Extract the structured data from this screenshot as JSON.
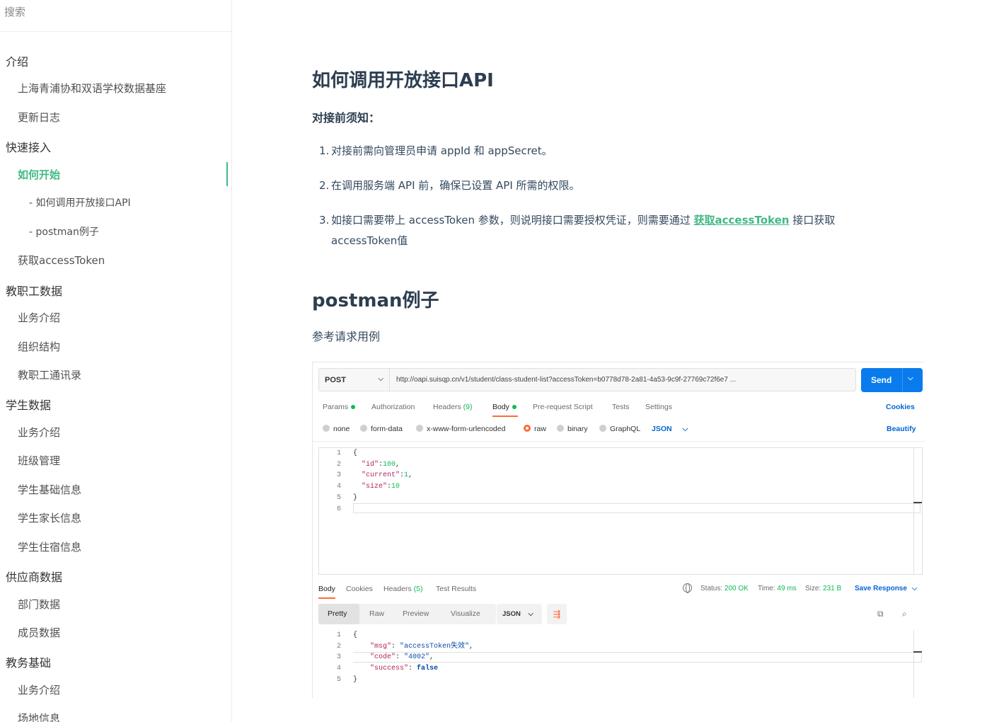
{
  "search": {
    "placeholder": "搜索"
  },
  "sidebar": {
    "items": [
      {
        "label": "介绍",
        "level": 0
      },
      {
        "label": "上海青浦协和双语学校数据基座",
        "level": 1
      },
      {
        "label": "更新日志",
        "level": 1
      },
      {
        "label": "快速接入",
        "level": 0
      },
      {
        "label": "如何开始",
        "level": 1,
        "active": true
      },
      {
        "label": "- 如何调用开放接口API",
        "level": 2
      },
      {
        "label": "- postman例子",
        "level": 2
      },
      {
        "label": "获取accessToken",
        "level": 1
      },
      {
        "label": "教职工数据",
        "level": 0
      },
      {
        "label": "业务介绍",
        "level": 1
      },
      {
        "label": "组织结构",
        "level": 1
      },
      {
        "label": "教职工通讯录",
        "level": 1
      },
      {
        "label": "学生数据",
        "level": 0
      },
      {
        "label": "业务介绍",
        "level": 1
      },
      {
        "label": "班级管理",
        "level": 1
      },
      {
        "label": "学生基础信息",
        "level": 1
      },
      {
        "label": "学生家长信息",
        "level": 1
      },
      {
        "label": "学生住宿信息",
        "level": 1
      },
      {
        "label": "供应商数据",
        "level": 0
      },
      {
        "label": "部门数据",
        "level": 1
      },
      {
        "label": "成员数据",
        "level": 1
      },
      {
        "label": "教务基础",
        "level": 0
      },
      {
        "label": "业务介绍",
        "level": 1
      },
      {
        "label": "场地信息",
        "level": 1
      }
    ]
  },
  "main": {
    "title": "如何调用开放接口API",
    "notice": "对接前须知：",
    "list": [
      {
        "num": "1.",
        "text": "对接前需向管理员申请 appId 和 appSecret。"
      },
      {
        "num": "2.",
        "text": "在调用服务端 API 前，确保已设置 API 所需的权限。"
      },
      {
        "num": "3.",
        "text_before": "如接口需要带上 accessToken 参数，则说明接口需要授权凭证，则需要通过 ",
        "link": "获取accessToken",
        "text_after": " 接口获取accessToken值"
      }
    ],
    "section2_title": "postman例子",
    "section2_text": "参考请求用例"
  },
  "postman": {
    "method": "POST",
    "url": "http://oapi.suisqp.cn/v1/student/class-student-list?accessToken=b0778d78-2a81-4a53-9c9f-27769c72f6e7 ...",
    "send": "Send",
    "tabs": [
      {
        "label": "Params",
        "dot": true
      },
      {
        "label": "Authorization"
      },
      {
        "label": "Headers",
        "count": "(9)"
      },
      {
        "label": "Body",
        "dot": true,
        "active": true
      },
      {
        "label": "Pre-request Script"
      },
      {
        "label": "Tests"
      },
      {
        "label": "Settings"
      }
    ],
    "cookies": "Cookies",
    "beautify": "Beautify",
    "body_types": [
      "none",
      "form-data",
      "x-www-form-urlencoded",
      "raw",
      "binary",
      "GraphQL"
    ],
    "body_type_selected": "raw",
    "body_format": "JSON",
    "request_lines": [
      "1",
      "2",
      "3",
      "4",
      "5",
      "6"
    ],
    "request_body": {
      "open": "{",
      "k1": "\"id\"",
      "v1": "100",
      "k2": "\"current\"",
      "v2": "1",
      "k3": "\"size\"",
      "v3": "10",
      "close": "}"
    },
    "response_tabs": [
      {
        "label": "Body",
        "active": true
      },
      {
        "label": "Cookies"
      },
      {
        "label": "Headers",
        "count": "(5)"
      },
      {
        "label": "Test Results"
      }
    ],
    "status_label": "Status:",
    "status_value": "200 OK",
    "time_label": "Time:",
    "time_value": "49 ms",
    "size_label": "Size:",
    "size_value": "231 B",
    "save_response": "Save Response",
    "format_tabs": [
      "Pretty",
      "Raw",
      "Preview",
      "Visualize"
    ],
    "format_selected": "Pretty",
    "response_format": "JSON",
    "response_lines": [
      "1",
      "2",
      "3",
      "4",
      "5"
    ],
    "response_body": {
      "open": "{",
      "k1": "\"msg\"",
      "v1": "\"accessToken失效\"",
      "k2": "\"code\"",
      "v2": "\"4002\"",
      "k3": "\"success\"",
      "v3": "false",
      "close": "}"
    }
  }
}
